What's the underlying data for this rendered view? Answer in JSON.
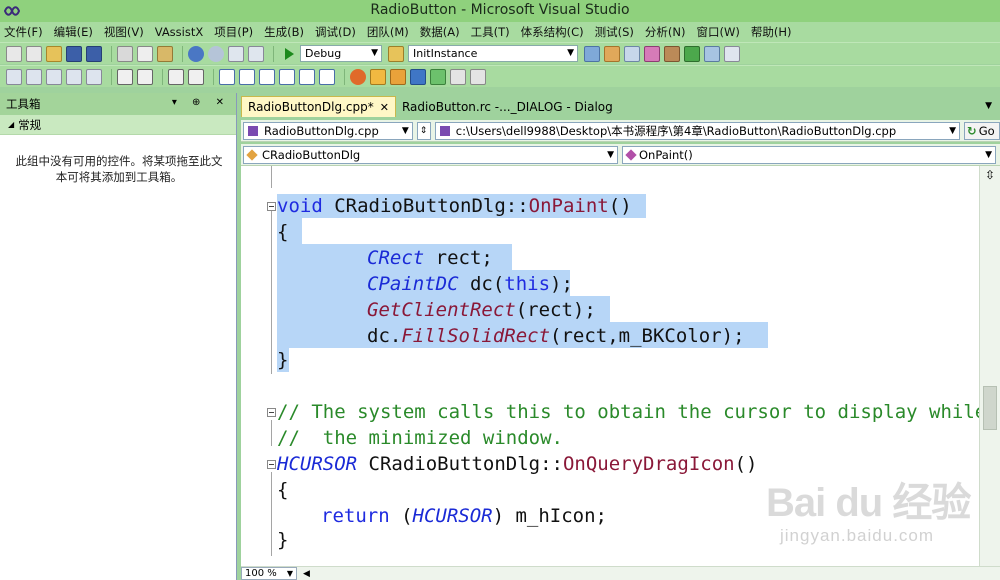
{
  "window": {
    "title": "RadioButton - Microsoft Visual Studio"
  },
  "menu": [
    "文件(F)",
    "编辑(E)",
    "视图(V)",
    "VAssistX",
    "项目(P)",
    "生成(B)",
    "调试(D)",
    "团队(M)",
    "数据(A)",
    "工具(T)",
    "体系结构(C)",
    "测试(S)",
    "分析(N)",
    "窗口(W)",
    "帮助(H)"
  ],
  "toolbar": {
    "config_value": "Debug",
    "function_value": "InitInstance"
  },
  "toolbox": {
    "title": "工具箱",
    "header_controls": "▾ ⊕ ✕",
    "group_label": "常规",
    "empty_message": "此组中没有可用的控件。将某项拖至此文本可将其添加到工具箱。"
  },
  "tabs": [
    {
      "label": "RadioButtonDlg.cpp*",
      "close": "✕",
      "active": true
    },
    {
      "label": "RadioButton.rc -..._DIALOG - Dialog",
      "active": false
    }
  ],
  "navigation": {
    "file_combo": "RadioButtonDlg.cpp",
    "path_combo": "c:\\Users\\dell9988\\Desktop\\本书源程序\\第4章\\RadioButton\\RadioButtonDlg.cpp",
    "go_label": "Go",
    "class_combo": "CRadioButtonDlg",
    "member_combo": "OnPaint()"
  },
  "code": {
    "l1": [
      "void",
      " CRadioButtonDlg::",
      "OnPaint",
      "()"
    ],
    "l2": "{",
    "l3": [
      "CRect",
      " rect;"
    ],
    "l4": [
      "CPaintDC",
      " dc(",
      "this",
      ");"
    ],
    "l5": [
      "GetClientRect",
      "(rect);"
    ],
    "l6": [
      "dc.",
      "FillSolidRect",
      "(rect,m_BKColor);"
    ],
    "l7": "}",
    "l8": "// The system calls this to obtain the cursor to display while t",
    "l9": "//  the minimized window.",
    "l10": [
      "HCURSOR",
      " CRadioButtonDlg::",
      "OnQueryDragIcon",
      "()"
    ],
    "l11": "{",
    "l12": [
      "return",
      " (",
      "HCURSOR",
      ") m_hIcon;"
    ],
    "l13": "}"
  },
  "status": {
    "zoom": "100 %"
  },
  "watermark": {
    "logo": "Bai du 经验",
    "url": "jingyan.baidu.com"
  }
}
